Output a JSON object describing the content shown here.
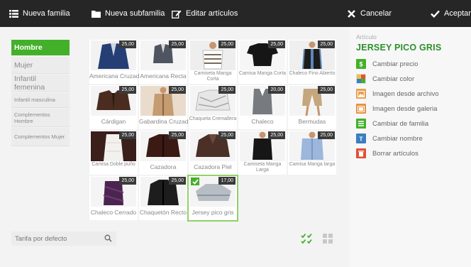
{
  "toolbar": {
    "new_family": "Nueva familia",
    "new_subfamily": "Nueva subfamilia",
    "edit_articles": "Editar artículos",
    "cancel": "Cancelar",
    "accept": "Aceptar"
  },
  "categories": [
    {
      "label": "Hombre",
      "active": true
    },
    {
      "label": "Mujer"
    },
    {
      "label": "Infantil femenina"
    },
    {
      "label": "Infantil masculina"
    },
    {
      "label": "Complementos Hombre"
    },
    {
      "label": "Complementos Mujer"
    }
  ],
  "products": [
    {
      "name": "Americana Cruzada",
      "price": "25,00"
    },
    {
      "name": "Americana Recta",
      "price": "25,00"
    },
    {
      "name": "Camiseta Manga Corta",
      "price": "25,00"
    },
    {
      "name": "Camisa Manga Corta",
      "price": "25,00"
    },
    {
      "name": "Chaleco Fino Abierto",
      "price": "25,00"
    },
    {
      "name": "Cárdigan",
      "price": "25,00"
    },
    {
      "name": "Gabardina Cruzada",
      "price": "25,00"
    },
    {
      "name": "Chaqueta Cremallera",
      "price": "25,00"
    },
    {
      "name": "Chaleco",
      "price": "20,00"
    },
    {
      "name": "Bermudas",
      "price": "25,00"
    },
    {
      "name": "Camisa Doble puño",
      "price": "25,00"
    },
    {
      "name": "Cazadora",
      "price": "25,00"
    },
    {
      "name": "Cazadora Piel",
      "price": "25,00"
    },
    {
      "name": "Camiseta Manga Larga",
      "price": "25,00"
    },
    {
      "name": "Camisa Manga larga",
      "price": "25,00"
    },
    {
      "name": "Chaleco Cerrado",
      "price": "25,00"
    },
    {
      "name": "Chaquetón Recto",
      "price": "25,00"
    },
    {
      "name": "Jersey pico gris",
      "price": "17,00",
      "selected": true
    }
  ],
  "tariff": {
    "value": "Tarifa por defecto"
  },
  "panel": {
    "label": "Artículo",
    "title": "JERSEY PICO GRIS",
    "actions": [
      {
        "label": "Cambiar precio",
        "icon": "dollar-icon",
        "color": "#43b02a"
      },
      {
        "label": "Cambiar color",
        "icon": "palette-icon",
        "color": "#f0c040"
      },
      {
        "label": "Imagen desde archivo",
        "icon": "image-file-icon",
        "color": "#e8a050"
      },
      {
        "label": "Imagen desde galeria",
        "icon": "gallery-icon",
        "color": "#e89040"
      },
      {
        "label": "Cambiar de familia",
        "icon": "family-icon",
        "color": "#43b02a"
      },
      {
        "label": "Cambiar nombre",
        "icon": "text-icon",
        "color": "#3a7fc0"
      },
      {
        "label": "Borrar artículos",
        "icon": "trash-icon",
        "color": "#e0503a"
      }
    ]
  }
}
